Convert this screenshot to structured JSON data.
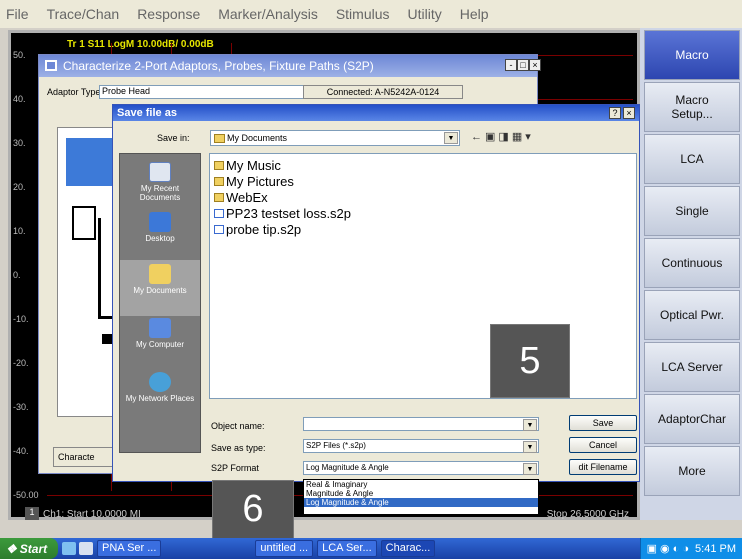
{
  "menubar": [
    "File",
    "Trace/Chan",
    "Response",
    "Marker/Analysis",
    "Stimulus",
    "Utility",
    "Help"
  ],
  "plot": {
    "trace_label": "Tr 1  S11 LogM 10.00dB/  0.00dB",
    "y_ticks": [
      "50.",
      "40.",
      "30.",
      "20.",
      "10.",
      "0.",
      "-10.",
      "-20.",
      "-30.",
      "-40.",
      "-50.00"
    ],
    "channel_number": "1",
    "start_label": "Ch1: Start  10.0000 MI",
    "stop_label": "Stop  26.5000 GHz",
    "trace_color": "#e6e600"
  },
  "softkeys": [
    "Macro",
    "Macro Setup...",
    "LCA",
    "Single",
    "Continuous",
    "Optical Pwr.",
    "LCA Server",
    "AdaptorChar",
    "More"
  ],
  "char_dialog": {
    "title": "Characterize 2-Port Adaptors, Probes, Fixture Paths (S2P)",
    "adaptor_type_label": "Adaptor Type:",
    "adaptor_type_value": "Probe Head",
    "connected_label": "Connected: A-N5242A-0124",
    "characterize_button": "Characte"
  },
  "save_dialog": {
    "title": "Save file as",
    "help_button": "?",
    "close_button": "×",
    "save_in_label": "Save in:",
    "save_in_value": "My Documents",
    "places": [
      {
        "label": "My Recent Documents",
        "icon": "recent-docs-icon"
      },
      {
        "label": "Desktop",
        "icon": "desktop-icon"
      },
      {
        "label": "My Documents",
        "icon": "my-documents-icon"
      },
      {
        "label": "My Computer",
        "icon": "my-computer-icon"
      },
      {
        "label": "My Network Places",
        "icon": "network-places-icon"
      }
    ],
    "files": [
      {
        "name": "My Music",
        "type": "folder"
      },
      {
        "name": "My Pictures",
        "type": "folder"
      },
      {
        "name": "WebEx",
        "type": "folder"
      },
      {
        "name": "PP23 testset loss.s2p",
        "type": "file"
      },
      {
        "name": "probe tip.s2p",
        "type": "file"
      }
    ],
    "object_name_label": "Object name:",
    "object_name_value": "",
    "save_as_type_label": "Save as type:",
    "save_as_type_value": "S2P Files (*.s2p)",
    "format_label": "S2P Format",
    "format_value": "Log Magnitude & Angle",
    "format_options": [
      "Real & Imaginary",
      "Magnitude & Angle",
      "Log Magnitude & Angle"
    ],
    "save_button": "Save",
    "cancel_button": "Cancel",
    "edit_filename_button": "dit Filename"
  },
  "badges": {
    "five": "5",
    "six": "6"
  },
  "taskbar": {
    "start": "Start",
    "tasks": [
      "PNA Ser ...",
      "untitled ...",
      "LCA Ser...",
      "Charac..."
    ],
    "clock": "5:41 PM"
  }
}
